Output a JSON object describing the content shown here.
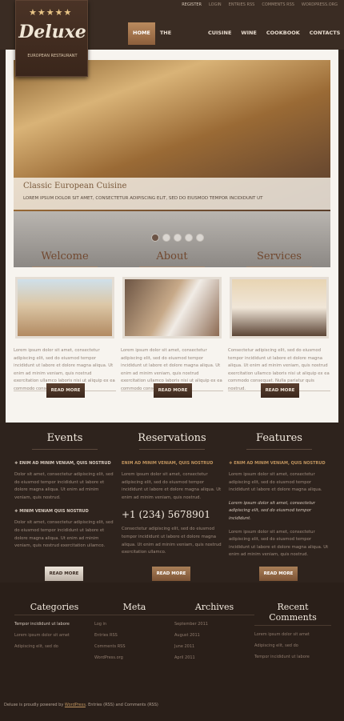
{
  "toplinks": [
    "Register",
    "Login",
    "Entries RSS",
    "Comments RSS",
    "WordPress.org"
  ],
  "logo": {
    "name": "Deluxe",
    "subtitle": "European Restaurant",
    "stars": "★★★★★"
  },
  "nav": [
    "Home",
    "The Restaurant",
    "Cuisine",
    "Wine List",
    "Cookbook",
    "Contacts"
  ],
  "slider": {
    "title": "Classic European Cuisine",
    "text": "LOREM IPSUM DOLOR SIT AMET, CONSECTETUR ADIPISCING ELIT, SED DO EIUSMOD TEMPOR INCIDIDUNT UT"
  },
  "columns": [
    {
      "title": "Welcome",
      "text": "Lorem ipsum dolor sit amet, consectetur adipiscing elit, sed do eiusmod tempor incididunt ut labore et dolore magna aliqua. Ut enim ad minim veniam, quis nostrud exercitation ullamco laboris nisi ut aliquip ex ea commodo consequat.",
      "button": "Read More"
    },
    {
      "title": "About",
      "text": "Lorem ipsum dolor sit amet, consectetur adipiscing elit, sed do eiusmod tempor incididunt ut labore et dolore magna aliqua. Ut enim ad minim veniam, quis nostrud exercitation ullamco laboris nisi ut aliquip ex ea commodo consequat.",
      "button": "Read More"
    },
    {
      "title": "Services",
      "text": "Consectetur adipiscing elit, sed do eiusmod tempor incididunt ut labore et dolore magna aliqua. Ut enim ad minim veniam, quis nostrud exercitation ullamco laboris nisi ut aliquip ex ea commodo consequat. Nulla pariatur quis nostrud.",
      "button": "Read More"
    }
  ],
  "events": {
    "title": "Events",
    "item1": "Enim ad minim veniam, quis nostrud",
    "text1": "Dolor sit amet, consectetur adipiscing elit, sed do eiusmod tempor incididunt ut labore et dolore magna aliqua. Ut enim ad minim veniam, quis nostrud.",
    "item2": "Minim veniam quis nostrud",
    "text2": "Dolor sit amet, consectetur adipiscing elit, sed do eiusmod tempor incididunt ut labore et dolore magna aliqua. Ut enim ad minim veniam, quis nostrud exercitation ullamco.",
    "button": "Read More"
  },
  "reservations": {
    "title": "Reservations",
    "item": "Enim ad minim veniam, quis nostrud",
    "text1": "Lorem ipsum dolor sit amet, consectetur adipiscing elit, sed do eiusmod tempor incididunt ut labore et dolore magna aliqua. Ut enim ad minim veniam, quis nostrud.",
    "phone": "+1 (234) 5678901",
    "text2": "Consectetur adipiscing elit, sed do eiusmod tempor incididunt ut labore et dolore magna aliqua. Ut enim ad minim veniam, quis nostrud exercitation ullamco.",
    "button": "Read More"
  },
  "features": {
    "title": "Features",
    "item": "Enim ad minim veniam, quis nostrud",
    "text1": "Lorem ipsum dolor sit amet, consectetur adipiscing elit, sed do eiusmod tempor incididunt ut labore et dolore magna aliqua.",
    "italic": "Lorem ipsum dolor sit amet, consectetur adipiscing elit, sed do eiusmod tempor incididunt.",
    "text2": "Lorem ipsum dolor sit amet, consectetur adipiscing elit, sed do eiusmod tempor incididunt ut labore et dolore magna aliqua. Ut enim ad minim veniam, quis nostrud.",
    "button": "Read More"
  },
  "footer": {
    "categories": {
      "title": "Categories",
      "links": [
        "Tempor incididunt ut labore",
        "Lorem ipsum dolor sit amet",
        "Adipiscing elit, sed do"
      ]
    },
    "meta": {
      "title": "Meta",
      "links": [
        "Log in",
        "Entries RSS",
        "Comments RSS",
        "WordPress.org"
      ]
    },
    "archives": {
      "title": "Archives",
      "links": [
        "September 2011",
        "August 2011",
        "June 2011",
        "April 2011"
      ]
    },
    "recent": {
      "title": "Recent Comments",
      "links": [
        "Lorem ipsum dolor sit amet",
        "Adipiscing elit, sed do",
        "Tempor incididunt ut labore"
      ]
    },
    "copyright": {
      "prefix": "Deluxe is proudly powered by",
      "wp": "WordPress",
      "suffix": "Entries (RSS) and Comments (RSS)"
    }
  }
}
